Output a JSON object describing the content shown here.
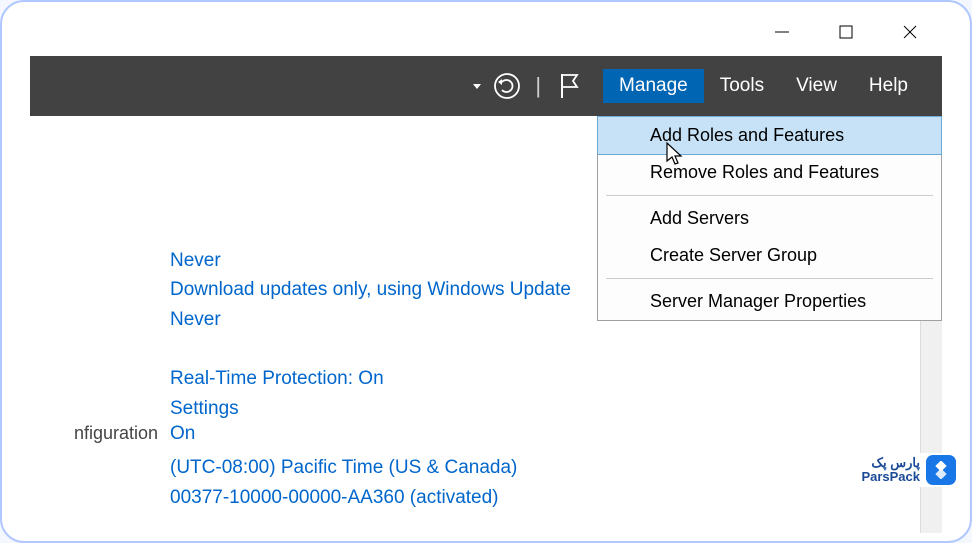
{
  "title_controls": {
    "minimize": "minimize",
    "maximize": "maximize",
    "close": "close"
  },
  "toolbar": {
    "manage": "Manage",
    "tools": "Tools",
    "view": "View",
    "help": "Help"
  },
  "manage_menu": {
    "add_roles": "Add Roles and Features",
    "remove_roles": "Remove Roles and Features",
    "add_servers": "Add Servers",
    "create_group": "Create Server Group",
    "properties": "Server Manager Properties"
  },
  "content": {
    "line1": "Never",
    "line2": "Download updates only, using Windows Update",
    "line3": "Never",
    "line4": "Real-Time Protection: On",
    "line5": "Settings",
    "config_label": "nfiguration",
    "line6": "On",
    "line7": "(UTC-08:00) Pacific Time (US & Canada)",
    "line8": "00377-10000-00000-AA360 (activated)"
  },
  "watermark": {
    "brand_fa": "پارس پک",
    "brand_en": "ParsPack"
  }
}
